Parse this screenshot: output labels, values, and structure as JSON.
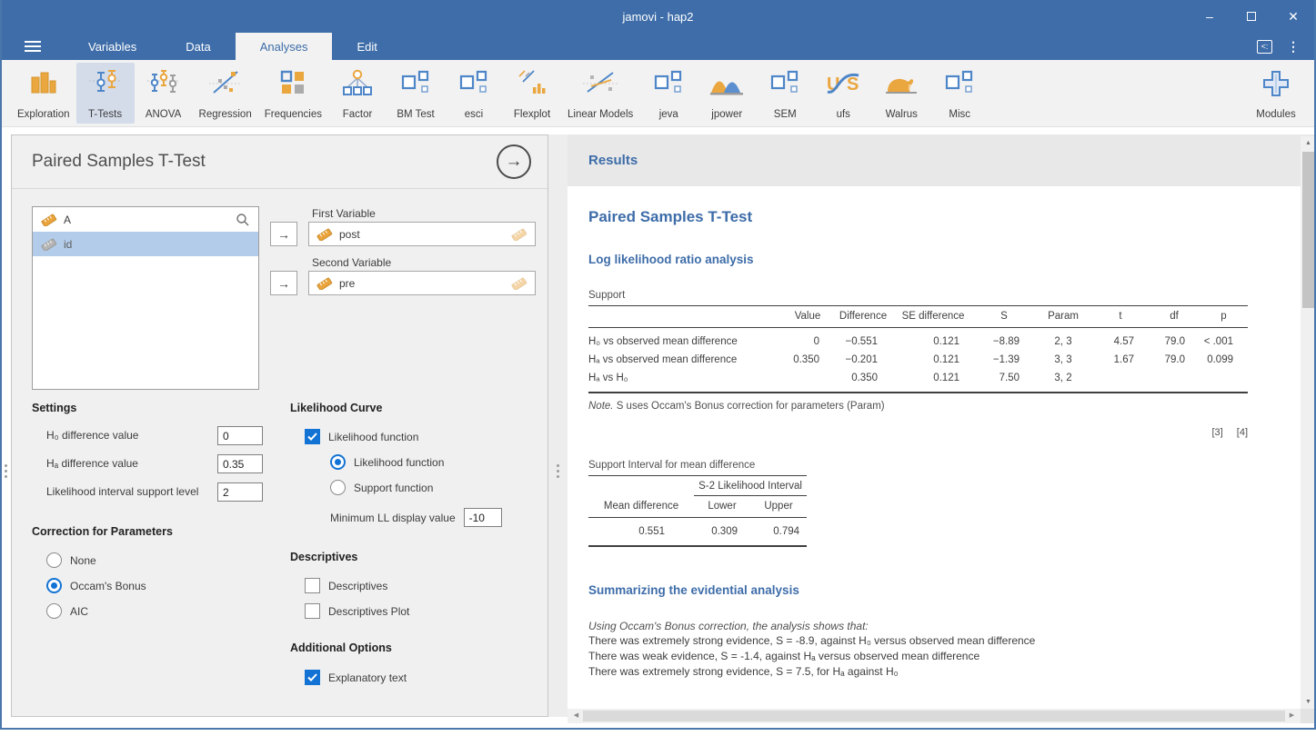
{
  "window": {
    "title": "jamovi - hap2",
    "controls": {
      "minimize": "–",
      "close": "✕"
    }
  },
  "menubar": {
    "tabs": [
      {
        "label": "Variables",
        "active": false
      },
      {
        "label": "Data",
        "active": false
      },
      {
        "label": "Analyses",
        "active": true
      },
      {
        "label": "Edit",
        "active": false
      }
    ]
  },
  "ribbon": {
    "items": [
      {
        "label": "Exploration",
        "icon": "bar-chart-icon",
        "selected": false
      },
      {
        "label": "T-Tests",
        "icon": "errorbar-pair-icon",
        "selected": true
      },
      {
        "label": "ANOVA",
        "icon": "errorbar-trio-icon",
        "selected": false
      },
      {
        "label": "Regression",
        "icon": "regression-line-icon",
        "selected": false
      },
      {
        "label": "Frequencies",
        "icon": "grid-squares-icon",
        "selected": false
      },
      {
        "label": "Factor",
        "icon": "factor-tree-icon",
        "selected": false
      },
      {
        "label": "BM Test",
        "icon": "module-squares-icon",
        "selected": false
      },
      {
        "label": "esci",
        "icon": "module-squares-icon",
        "selected": false
      },
      {
        "label": "Flexplot",
        "icon": "flexplot-icon",
        "selected": false
      },
      {
        "label": "Linear Models",
        "icon": "linear-models-icon",
        "selected": false
      },
      {
        "label": "jeva",
        "icon": "module-squares-icon",
        "selected": false
      },
      {
        "label": "jpower",
        "icon": "distributions-icon",
        "selected": false
      },
      {
        "label": "SEM",
        "icon": "module-squares-icon",
        "selected": false
      },
      {
        "label": "ufs",
        "icon": "ufs-logo-icon",
        "selected": false
      },
      {
        "label": "Walrus",
        "icon": "walrus-icon",
        "selected": false
      },
      {
        "label": "Misc",
        "icon": "module-squares-icon",
        "selected": false
      }
    ],
    "modules": {
      "label": "Modules"
    }
  },
  "options": {
    "title": "Paired Samples T-Test",
    "variables": {
      "items": [
        {
          "label": "A"
        },
        {
          "label": "id",
          "selected": true
        }
      ]
    },
    "first_variable": {
      "label": "First Variable",
      "value": "post"
    },
    "second_variable": {
      "label": "Second Variable",
      "value": "pre"
    },
    "settings": {
      "heading": "Settings",
      "fields": [
        {
          "label": "H₀ difference value",
          "value": "0"
        },
        {
          "label": "Hₐ difference value",
          "value": "0.35"
        },
        {
          "label": "Likelihood interval support level",
          "value": "2"
        }
      ]
    },
    "correction": {
      "heading": "Correction for Parameters",
      "options": [
        {
          "label": "None",
          "selected": false
        },
        {
          "label": "Occam's Bonus",
          "selected": true
        },
        {
          "label": "AIC",
          "selected": false
        }
      ]
    },
    "likelihood": {
      "heading": "Likelihood Curve",
      "function_checkbox": {
        "label": "Likelihood function",
        "checked": true
      },
      "function_radio": {
        "label": "Likelihood function",
        "selected": true
      },
      "support_radio": {
        "label": "Support function",
        "selected": false
      },
      "min_ll": {
        "label": "Minimum LL display value",
        "value": "-10"
      }
    },
    "descriptives": {
      "heading": "Descriptives",
      "items": [
        {
          "label": "Descriptives",
          "checked": false
        },
        {
          "label": "Descriptives Plot",
          "checked": false
        }
      ]
    },
    "additional": {
      "heading": "Additional Options",
      "explanatory": {
        "label": "Explanatory text",
        "checked": true
      }
    }
  },
  "results": {
    "header": "Results",
    "title": "Paired Samples T-Test",
    "section": "Log likelihood ratio analysis",
    "support": {
      "title": "Support",
      "headers": [
        "",
        "Value",
        "Difference",
        "SE difference",
        "S",
        "Param",
        "t",
        "df",
        "p"
      ],
      "rows": [
        [
          "H₀ vs observed mean difference",
          "0",
          "−0.551",
          "0.121",
          "−8.89",
          "2, 3",
          "4.57",
          "79.0",
          "< .001"
        ],
        [
          "Hₐ vs observed mean difference",
          "0.350",
          "−0.201",
          "0.121",
          "−1.39",
          "3, 3",
          "1.67",
          "79.0",
          "0.099"
        ],
        [
          "Hₐ vs H₀",
          "",
          "0.350",
          "0.121",
          "7.50",
          "3, 2",
          "",
          "",
          ""
        ]
      ],
      "note_label": "Note.",
      "note_text": " S uses Occam's Bonus correction for parameters (Param)"
    },
    "references": [
      "[3]",
      "[4]"
    ],
    "support_interval": {
      "title": "Support Interval for mean difference",
      "span_header": "S-2 Likelihood Interval",
      "headers": [
        "Mean difference",
        "Lower",
        "Upper"
      ],
      "row": [
        "0.551",
        "0.309",
        "0.794"
      ]
    },
    "summary": {
      "heading": "Summarizing the evidential analysis",
      "intro": "Using Occam's Bonus correction, the analysis shows that:",
      "lines": [
        "There was extremely strong evidence, S = -8.9, against H₀ versus observed mean difference",
        "There was weak evidence, S = -1.4, against Hₐ versus observed mean difference",
        "There was extremely strong evidence, S = 7.5, for Hₐ against H₀"
      ]
    },
    "colors": {
      "accent_blue": "#3e6da9",
      "selection_blue": "#b3cce9",
      "control_blue": "#1373d4",
      "icon_orange": "#eaa63f",
      "icon_blue": "#4e86c8"
    }
  }
}
